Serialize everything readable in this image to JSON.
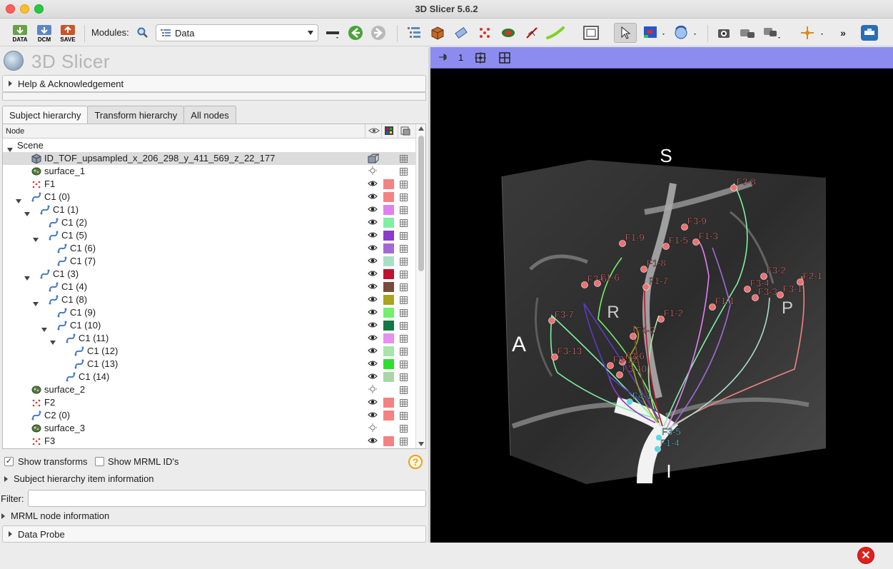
{
  "window": {
    "title": "3D Slicer 5.6.2"
  },
  "toolbar": {
    "data_btn": "DATA",
    "dcm_btn": "DCM",
    "save_btn": "SAVE",
    "modules_label": "Modules:",
    "module_value": "Data"
  },
  "brand": {
    "logo_text": "3D Slicer"
  },
  "help_section": "Help & Acknowledgement",
  "tabs": [
    "Subject hierarchy",
    "Transform hierarchy",
    "All nodes"
  ],
  "tree": {
    "header": {
      "node": "Node"
    },
    "rows": [
      {
        "label": "Scene",
        "kind": "scene",
        "depth": 0,
        "expanded": true,
        "vis": "none",
        "color": null
      },
      {
        "label": "ID_TOF_upsampled_x_206_298_y_411_569_z_22_177",
        "kind": "volume",
        "depth": 1,
        "expanded": null,
        "vis": "volume",
        "color": null,
        "selected": true
      },
      {
        "label": "surface_1",
        "kind": "surface",
        "depth": 1,
        "expanded": null,
        "vis": "hidden",
        "color": null
      },
      {
        "label": "F1",
        "kind": "points",
        "depth": 1,
        "expanded": null,
        "vis": "eye",
        "color": "#f48282"
      },
      {
        "label": "C1 (0)",
        "kind": "curve",
        "depth": 1,
        "expanded": true,
        "vis": "eye",
        "color": "#f48282"
      },
      {
        "label": "C1 (1)",
        "kind": "curve",
        "depth": 2,
        "expanded": true,
        "vis": "eye",
        "color": "#df82f0"
      },
      {
        "label": "C1 (2)",
        "kind": "curve",
        "depth": 3,
        "expanded": null,
        "vis": "eye",
        "color": "#7ef0a4"
      },
      {
        "label": "C1 (5)",
        "kind": "curve",
        "depth": 3,
        "expanded": true,
        "vis": "eye",
        "color": "#8a3bc9"
      },
      {
        "label": "C1 (6)",
        "kind": "curve",
        "depth": 4,
        "expanded": null,
        "vis": "eye",
        "color": "#a36ad6"
      },
      {
        "label": "C1 (7)",
        "kind": "curve",
        "depth": 4,
        "expanded": null,
        "vis": "eye",
        "color": "#a8e0c6"
      },
      {
        "label": "C1 (3)",
        "kind": "curve",
        "depth": 2,
        "expanded": true,
        "vis": "eye",
        "color": "#c2102f"
      },
      {
        "label": "C1 (4)",
        "kind": "curve",
        "depth": 3,
        "expanded": null,
        "vis": "eye",
        "color": "#7a4a3a"
      },
      {
        "label": "C1 (8)",
        "kind": "curve",
        "depth": 3,
        "expanded": true,
        "vis": "eye",
        "color": "#a8a51e"
      },
      {
        "label": "C1 (9)",
        "kind": "curve",
        "depth": 4,
        "expanded": null,
        "vis": "eye",
        "color": "#72f06e"
      },
      {
        "label": "C1 (10)",
        "kind": "curve",
        "depth": 4,
        "expanded": true,
        "vis": "eye",
        "color": "#117a44"
      },
      {
        "label": "C1 (11)",
        "kind": "curve",
        "depth": 5,
        "expanded": true,
        "vis": "eye",
        "color": "#e690ef"
      },
      {
        "label": "C1 (12)",
        "kind": "curve",
        "depth": 6,
        "expanded": null,
        "vis": "eye",
        "color": "#a6e6aa"
      },
      {
        "label": "C1 (13)",
        "kind": "curve",
        "depth": 6,
        "expanded": null,
        "vis": "eye",
        "color": "#2ee02e"
      },
      {
        "label": "C1 (14)",
        "kind": "curve",
        "depth": 5,
        "expanded": null,
        "vis": "eye",
        "color": "#a8d6a8"
      },
      {
        "label": "surface_2",
        "kind": "surface",
        "depth": 1,
        "expanded": null,
        "vis": "hidden",
        "color": null
      },
      {
        "label": "F2",
        "kind": "points",
        "depth": 1,
        "expanded": null,
        "vis": "eye",
        "color": "#f48282"
      },
      {
        "label": "C2 (0)",
        "kind": "curve",
        "depth": 1,
        "expanded": null,
        "vis": "eye",
        "color": "#f48282"
      },
      {
        "label": "surface_3",
        "kind": "surface",
        "depth": 1,
        "expanded": null,
        "vis": "hidden",
        "color": null
      },
      {
        "label": "F3",
        "kind": "points",
        "depth": 1,
        "expanded": null,
        "vis": "eye",
        "color": "#f48282"
      }
    ]
  },
  "options": {
    "show_transforms": "Show transforms",
    "show_transforms_checked": true,
    "show_mrml_ids": "Show MRML ID's",
    "show_mrml_ids_checked": false,
    "help": "?"
  },
  "sh_info": "Subject hierarchy item information",
  "filter_label": "Filter:",
  "filter_value": "",
  "mrml_info": "MRML node information",
  "data_probe": "Data Probe",
  "view": {
    "view_number": "1",
    "accent": "#8c8cf0",
    "orientation": {
      "S": "S",
      "A": "A",
      "R": "R",
      "P": "P",
      "I": "I"
    },
    "landmarks_red": [
      "F3-8",
      "F3-9",
      "F1-9",
      "F1-5",
      "F1-3",
      "F1-8",
      "F3-6",
      "F1-6",
      "F1-7",
      "F3-2",
      "F2-1",
      "F3-4",
      "F3-3",
      "F3-1",
      "F1-1",
      "F3-7",
      "F1-2",
      "F4-2",
      "F3-13",
      "F3-6",
      "F3-12",
      "F3-10"
    ],
    "landmarks_cyan": [
      "F4-1",
      "F3-5",
      "F1-4"
    ]
  },
  "status": {
    "error_icon": "error-icon"
  }
}
